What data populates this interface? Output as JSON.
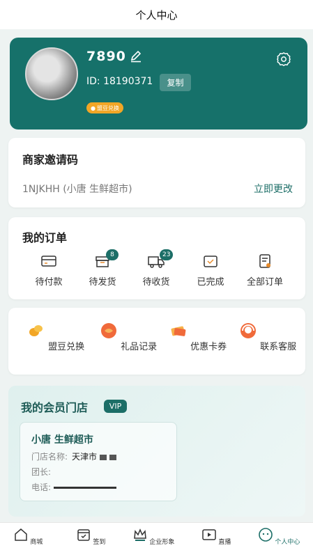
{
  "header": {
    "title": "个人中心"
  },
  "profile": {
    "username": "7890",
    "id_text": "ID: 18190371",
    "copy_label": "复制",
    "bean_badge": "盟豆兑换"
  },
  "invite": {
    "title": "商家邀请码",
    "code": "1NJKHH (小唐 生鲜超市)",
    "change_label": "立即更改"
  },
  "orders": {
    "title": "我的订单",
    "items": [
      {
        "label": "待付款",
        "icon": "wallet-icon"
      },
      {
        "label": "待发货",
        "icon": "box-icon",
        "badge": "8"
      },
      {
        "label": "待收货",
        "icon": "truck-icon",
        "badge": "23"
      },
      {
        "label": "已完成",
        "icon": "check-box-icon"
      },
      {
        "label": "全部订单",
        "icon": "order-list-icon"
      }
    ]
  },
  "services": {
    "items": [
      {
        "label": "盟豆兑换",
        "icon": "beans-icon"
      },
      {
        "label": "礼品记录",
        "icon": "gift-icon"
      },
      {
        "label": "优惠卡券",
        "icon": "coupon-icon"
      },
      {
        "label": "联系客服",
        "icon": "customer-service-icon"
      }
    ]
  },
  "member": {
    "title": "我的会员门店",
    "vip": "VIP",
    "store_name": "小唐 生鲜超市",
    "store_label": "门店名称:",
    "store_value": "天津市",
    "leader_label": "团长:",
    "phone_label": "电话:"
  },
  "nav": {
    "items": [
      {
        "label": "商城",
        "icon": "home-icon"
      },
      {
        "label": "签到",
        "icon": "calendar-icon"
      },
      {
        "label": "企业形象",
        "icon": "crown-icon"
      },
      {
        "label": "直播",
        "icon": "live-icon"
      },
      {
        "label": "个人中心",
        "icon": "profile-icon",
        "active": true
      }
    ]
  },
  "colors": {
    "primary": "#16716a",
    "accent": "#1c6e67",
    "badge_orange": "#f2a626"
  }
}
